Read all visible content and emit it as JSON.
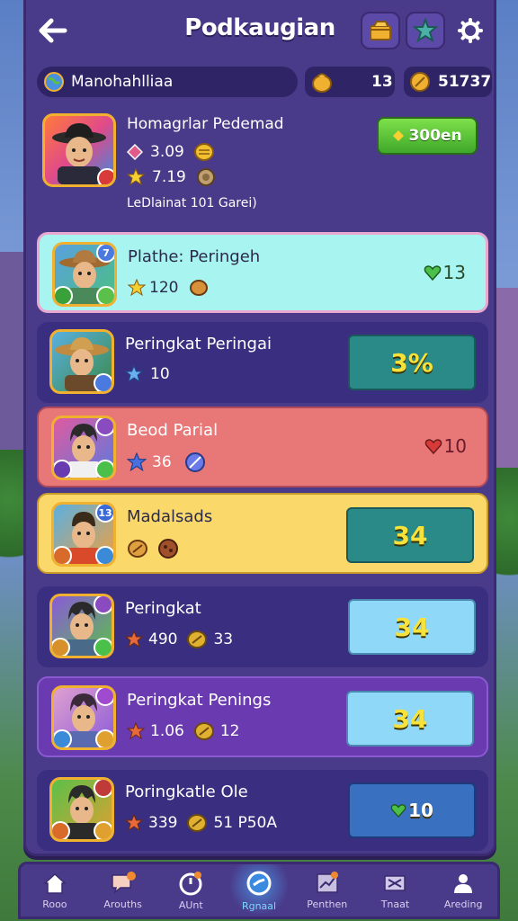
{
  "header": {
    "title": "Podkaugian"
  },
  "player": {
    "name": "Manohahlliaa"
  },
  "currency": {
    "gold": "13",
    "coins": "51737"
  },
  "profile": {
    "name": "Homagrlar Pedemad",
    "stat1": "3.09",
    "stat2": "7.19",
    "subtitle": "LeDlainat 101 Garei)",
    "button_label": "300en"
  },
  "rows": [
    {
      "name": "Plathe: Peringeh",
      "stat1": "120",
      "score": "13",
      "badge": "7"
    },
    {
      "name": "Peringkat Peringai",
      "stat1": "10",
      "score": "3%",
      "badge": ""
    },
    {
      "name": "Beod Parial",
      "stat1": "36",
      "score": "10",
      "badge": ""
    },
    {
      "name": "Madalsads",
      "stat1": "",
      "score": "34",
      "badge": "13"
    },
    {
      "name": "Peringkat",
      "stat1": "490",
      "stat2": "33",
      "score": "34",
      "badge": ""
    },
    {
      "name": "Peringkat Penings",
      "stat1": "1.06",
      "stat2": "12",
      "score": "34",
      "badge": ""
    },
    {
      "name": "Poringkatle Ole",
      "stat1": "339",
      "stat2": "51 P50A",
      "score": "10",
      "badge": ""
    }
  ],
  "nav": [
    {
      "label": "Rooo",
      "icon": "home-icon"
    },
    {
      "label": "Arouths",
      "icon": "chat-icon"
    },
    {
      "label": "AUnt",
      "icon": "timer-icon"
    },
    {
      "label": "Rgnaal",
      "icon": "compass-icon"
    },
    {
      "label": "Penthen",
      "icon": "chart-icon"
    },
    {
      "label": "Tnaat",
      "icon": "card-icon"
    },
    {
      "label": "Areding",
      "icon": "person-icon"
    }
  ],
  "colors": {
    "panel": "#4a3a8a",
    "row_cyan": "#9ff0f0",
    "row_red": "#e87878",
    "row_yellow": "#fbd86a",
    "row_purple": "#5a3aa0",
    "score_teal": "#2a8a8a",
    "score_light": "#8fd8f8",
    "score_blue": "#3a70c0"
  }
}
